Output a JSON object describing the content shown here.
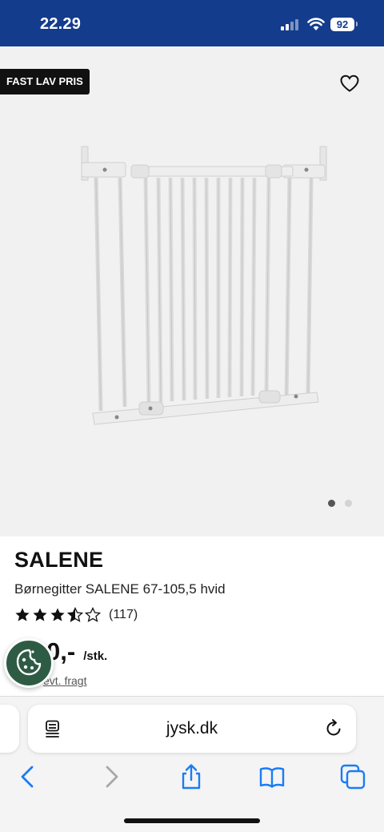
{
  "status_bar": {
    "time": "22.29",
    "battery": "92",
    "background": "#143c8c"
  },
  "gallery": {
    "badge": "FAST LAV PRIS",
    "image_count": 2,
    "active_image": 1
  },
  "product": {
    "brand": "SALENE",
    "subtitle": "Børnegitter SALENE 67-105,5 hvid",
    "rating": 3.5,
    "rating_max": 5,
    "review_count": "(117)",
    "price": "0,-",
    "price_unit": "/stk.",
    "shipping_note": "evt. fragt"
  },
  "browser": {
    "url": "jysk.dk",
    "icons": [
      "page-menu-icon",
      "reload-icon",
      "back-icon",
      "forward-icon",
      "share-icon",
      "bookmarks-icon",
      "tabs-icon"
    ]
  },
  "colors": {
    "accent_blue": "#1a7cf5",
    "cookie_green": "#2e5b44"
  }
}
